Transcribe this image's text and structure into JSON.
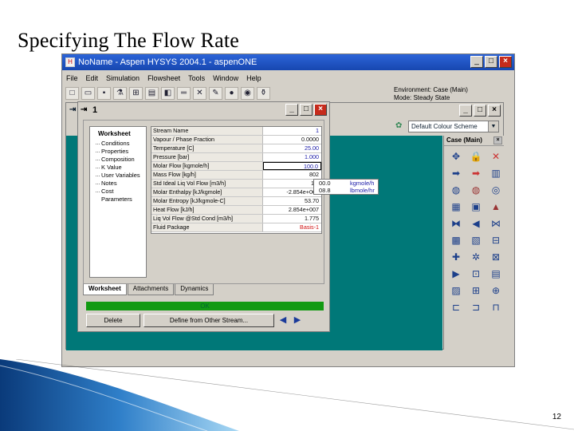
{
  "slide": {
    "title": "Specifying The Flow Rate",
    "page_number": "12"
  },
  "app": {
    "title": "NoName - Aspen HYSYS 2004.1 - aspenONE",
    "menu": [
      "File",
      "Edit",
      "Simulation",
      "Flowsheet",
      "Tools",
      "Window",
      "Help"
    ],
    "environment": "Environment: Case (Main)",
    "mode": "Mode: Steady State"
  },
  "pfd": {
    "tab_label": "1",
    "color_scheme": "Default Colour Scheme",
    "palette_title": "Case (Main)"
  },
  "dialog": {
    "title": "1",
    "nav_header": "Worksheet",
    "nav_items": [
      "Conditions",
      "Properties",
      "Composition",
      "K Value",
      "User Variables",
      "Notes",
      "Cost Parameters"
    ],
    "rows": [
      {
        "name": "Stream Name",
        "value": "1"
      },
      {
        "name": "Vapour / Phase Fraction",
        "value": "0.0000"
      },
      {
        "name": "Temperature [C]",
        "value": "25.00"
      },
      {
        "name": "Pressure [bar]",
        "value": "1.000"
      },
      {
        "name": "Molar Flow [kgmole/h]",
        "value": "100.0"
      },
      {
        "name": "Mass Flow [kg/h]",
        "value": "802"
      },
      {
        "name": "Std Ideal Liq Vol Flow [m3/h]",
        "value": "1.5"
      },
      {
        "name": "Molar Enthalpy [kJ/kgmole]",
        "value": "-2.854e+005"
      },
      {
        "name": "Molar Entropy [kJ/kgmole-C]",
        "value": "53.70"
      },
      {
        "name": "Heat Flow [kJ/h]",
        "value": "2.854e+007"
      },
      {
        "name": "Liq Vol Flow @Std Cond [m3/h]",
        "value": "1.775"
      },
      {
        "name": "Fluid Package",
        "value": "Basis-1"
      }
    ],
    "unit_popup": {
      "value_a": "00.0",
      "unit_a": "kgmole/h",
      "value_b": "08.8",
      "unit_b": "lbmole/hr"
    },
    "tabs": [
      "Worksheet",
      "Attachments",
      "Dynamics"
    ],
    "status": "OK",
    "buttons": {
      "delete": "Delete",
      "define": "Define from Other Stream..."
    }
  },
  "colors": {
    "canvas": "#007878",
    "status_ok": "#129a12",
    "titlebar": "#1747b0"
  }
}
